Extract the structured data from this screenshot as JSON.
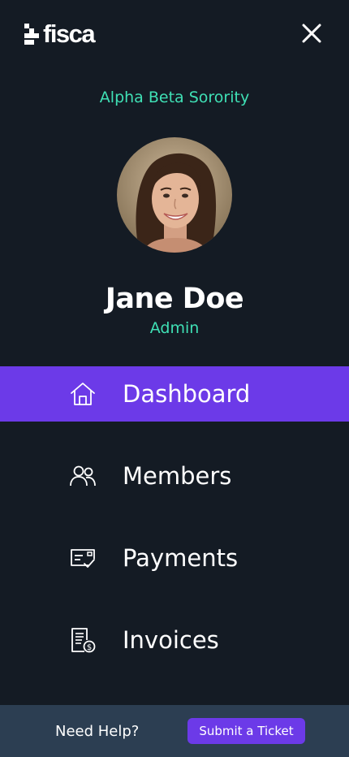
{
  "brand": {
    "logo_text": "fisca",
    "logo_icon": "fisca-logo-icon"
  },
  "header": {
    "close_icon": "close-icon"
  },
  "organization": {
    "name": "Alpha Beta Sorority"
  },
  "profile": {
    "name": "Jane Doe",
    "role": "Admin",
    "avatar": "avatar-photo"
  },
  "nav": {
    "items": [
      {
        "label": "Dashboard",
        "icon": "home-icon",
        "active": true
      },
      {
        "label": "Members",
        "icon": "members-icon",
        "active": false
      },
      {
        "label": "Payments",
        "icon": "payments-icon",
        "active": false
      },
      {
        "label": "Invoices",
        "icon": "invoices-icon",
        "active": false
      }
    ]
  },
  "footer": {
    "help_text": "Need Help?",
    "ticket_button": "Submit a Ticket"
  },
  "colors": {
    "background": "#141b24",
    "accent": "#6c3ae8",
    "highlight_text": "#3fe0b5",
    "footer": "#2c3e52"
  }
}
